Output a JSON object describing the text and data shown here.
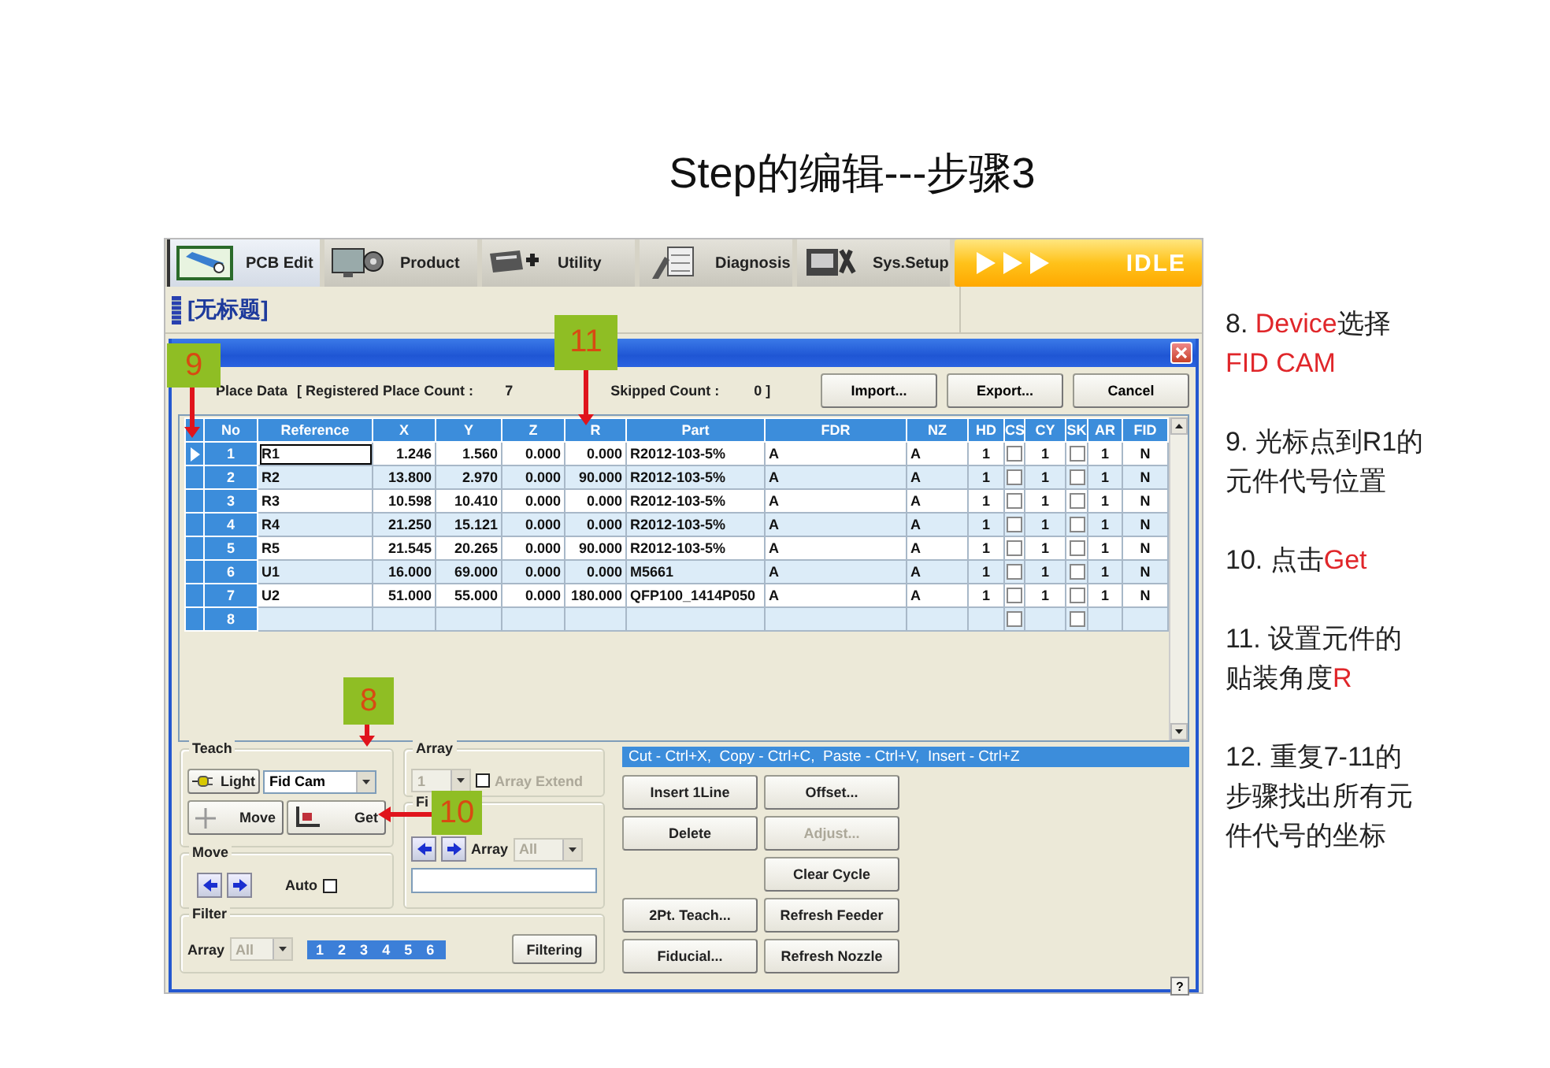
{
  "slide_title": "Step的编辑---步骤3",
  "app": {
    "tabs": [
      {
        "label": "PCB Edit",
        "selected": true,
        "kind": "pcb"
      },
      {
        "label": "Product",
        "selected": false,
        "kind": "product"
      },
      {
        "label": "Utility",
        "selected": false,
        "kind": "utility"
      },
      {
        "label": "Diagnosis",
        "selected": false,
        "kind": "diagnosis"
      },
      {
        "label": "Sys.Setup",
        "selected": false,
        "kind": "setup"
      }
    ],
    "status": "IDLE",
    "document_title": "[无标题]",
    "dialog": {
      "summary": {
        "label": "Place Data",
        "registered_label": "[ Registered Place Count :",
        "registered_count": "7",
        "skipped_label": "Skipped Count :",
        "skipped_count": "0 ]"
      },
      "header_buttons": [
        "Import...",
        "Export...",
        "Cancel"
      ],
      "table": {
        "columns": [
          {
            "label": "No",
            "kind": "index"
          },
          {
            "label": "Reference",
            "kind": "text"
          },
          {
            "label": "X",
            "kind": "number"
          },
          {
            "label": "Y",
            "kind": "number"
          },
          {
            "label": "Z",
            "kind": "number"
          },
          {
            "label": "R",
            "kind": "number"
          },
          {
            "label": "Part",
            "kind": "text"
          },
          {
            "label": "FDR",
            "kind": "text"
          },
          {
            "label": "NZ",
            "kind": "text"
          },
          {
            "label": "HD",
            "kind": "flag"
          },
          {
            "label": "CS",
            "kind": "check"
          },
          {
            "label": "CY",
            "kind": "flag"
          },
          {
            "label": "SK",
            "kind": "check"
          },
          {
            "label": "AR",
            "kind": "flag"
          },
          {
            "label": "FID",
            "kind": "flag"
          }
        ],
        "rows": [
          {
            "current": true,
            "cells": [
              "1",
              "R1",
              "1.246",
              "1.560",
              "0.000",
              "0.000",
              "R2012-103-5%",
              "A",
              "A",
              "1",
              false,
              "1",
              false,
              "1",
              "N"
            ]
          },
          {
            "current": false,
            "cells": [
              "2",
              "R2",
              "13.800",
              "2.970",
              "0.000",
              "90.000",
              "R2012-103-5%",
              "A",
              "A",
              "1",
              false,
              "1",
              false,
              "1",
              "N"
            ]
          },
          {
            "current": false,
            "cells": [
              "3",
              "R3",
              "10.598",
              "10.410",
              "0.000",
              "0.000",
              "R2012-103-5%",
              "A",
              "A",
              "1",
              false,
              "1",
              false,
              "1",
              "N"
            ]
          },
          {
            "current": false,
            "cells": [
              "4",
              "R4",
              "21.250",
              "15.121",
              "0.000",
              "0.000",
              "R2012-103-5%",
              "A",
              "A",
              "1",
              false,
              "1",
              false,
              "1",
              "N"
            ]
          },
          {
            "current": false,
            "cells": [
              "5",
              "R5",
              "21.545",
              "20.265",
              "0.000",
              "90.000",
              "R2012-103-5%",
              "A",
              "A",
              "1",
              false,
              "1",
              false,
              "1",
              "N"
            ]
          },
          {
            "current": false,
            "cells": [
              "6",
              "U1",
              "16.000",
              "69.000",
              "0.000",
              "0.000",
              "M5661",
              "A",
              "A",
              "1",
              false,
              "1",
              false,
              "1",
              "N"
            ]
          },
          {
            "current": false,
            "cells": [
              "7",
              "U2",
              "51.000",
              "55.000",
              "0.000",
              "180.000",
              "QFP100_1414P050",
              "A",
              "A",
              "1",
              false,
              "1",
              false,
              "1",
              "N"
            ]
          },
          {
            "current": false,
            "cells": [
              "8",
              null,
              null,
              null,
              null,
              null,
              null,
              null,
              null,
              null,
              false,
              null,
              false,
              null,
              null
            ]
          }
        ]
      },
      "teach": {
        "label": "Teach",
        "light_button": "Light",
        "device": "Fid Cam",
        "move_button": "Move",
        "get_button": "Get"
      },
      "array": {
        "label": "Array",
        "count": "1",
        "disabled": true,
        "extend_label": "Array Extend",
        "extend_checked": false
      },
      "fi": {
        "label": "Fi",
        "array_label": "Array",
        "array_value": "All",
        "disabled": true
      },
      "move": {
        "label": "Move",
        "auto_label": "Auto",
        "auto_checked": false
      },
      "filter": {
        "label": "Filter",
        "array_label": "Array",
        "array_value": "All",
        "disabled": true,
        "arrays": [
          "1",
          "2",
          "3",
          "4",
          "5",
          "6"
        ],
        "button": "Filtering"
      },
      "shortcut_hint": "Cut - Ctrl+X,  Copy - Ctrl+C,  Paste - Ctrl+V,  Insert - Ctrl+Z",
      "edit_buttons": [
        {
          "label": "Insert 1Line",
          "disabled": false
        },
        {
          "label": "Delete",
          "disabled": false
        }
      ],
      "teach_buttons": [
        {
          "label": "2Pt. Teach...",
          "disabled": false
        },
        {
          "label": "Fiducial...",
          "disabled": false
        }
      ],
      "side_buttons": [
        {
          "label": "Offset...",
          "disabled": false
        },
        {
          "label": "Adjust...",
          "disabled": true
        },
        {
          "label": "Clear Cycle",
          "disabled": false
        },
        {
          "label": "Refresh Feeder",
          "disabled": false
        },
        {
          "label": "Refresh Nozzle",
          "disabled": false
        }
      ],
      "help_button": "?"
    },
    "callouts": [
      {
        "label": "9"
      },
      {
        "label": "11"
      },
      {
        "label": "8"
      },
      {
        "label": "10"
      }
    ]
  },
  "notes": [
    {
      "lines": [
        [
          {
            "text": "8. ",
            "highlight": false
          },
          {
            "text": "Device",
            "highlight": true
          },
          {
            "text": "选择",
            "highlight": false
          }
        ],
        [
          {
            "text": "FID CAM",
            "highlight": true
          }
        ]
      ]
    },
    {
      "lines": [
        [
          {
            "text": "9. 光标点到R1的",
            "highlight": false
          }
        ],
        [
          {
            "text": "元件代号位置",
            "highlight": false
          }
        ]
      ]
    },
    {
      "lines": [
        [
          {
            "text": "10. 点击",
            "highlight": false
          },
          {
            "text": "Get",
            "highlight": true
          }
        ]
      ]
    },
    {
      "lines": [
        [
          {
            "text": "11. 设置元件的",
            "highlight": false
          }
        ],
        [
          {
            "text": "贴装角度",
            "highlight": false
          },
          {
            "text": "R",
            "highlight": true
          }
        ]
      ]
    },
    {
      "lines": [
        [
          {
            "text": "12. 重复7-11的",
            "highlight": false
          }
        ],
        [
          {
            "text": "步骤找出所有元",
            "highlight": false
          }
        ],
        [
          {
            "text": "件代号的坐标",
            "highlight": false
          }
        ]
      ]
    }
  ]
}
